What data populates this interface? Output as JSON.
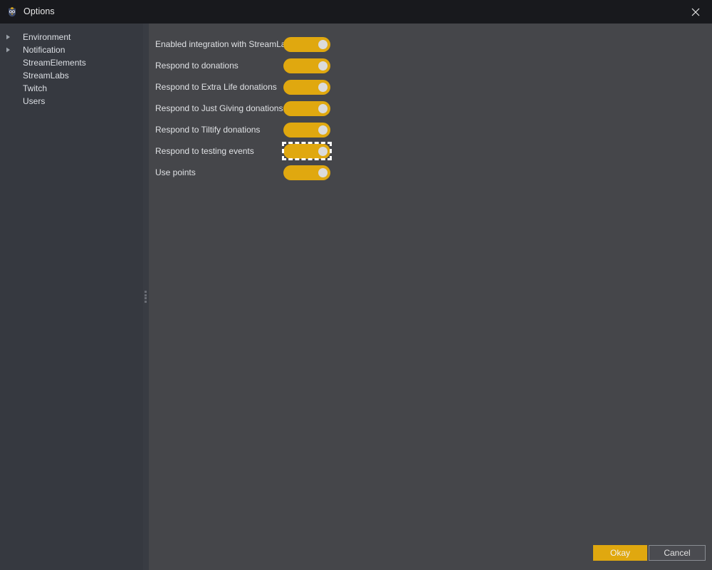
{
  "window": {
    "title": "Options",
    "icon": "app-owl-icon",
    "close_label": "✕"
  },
  "sidebar": {
    "items": [
      {
        "label": "Environment",
        "expandable": true,
        "selected": false
      },
      {
        "label": "Notification",
        "expandable": true,
        "selected": false
      },
      {
        "label": "StreamElements",
        "expandable": false,
        "selected": false
      },
      {
        "label": "StreamLabs",
        "expandable": false,
        "selected": false
      },
      {
        "label": "Twitch",
        "expandable": false,
        "selected": false
      },
      {
        "label": "Users",
        "expandable": false,
        "selected": false
      }
    ]
  },
  "main": {
    "options": [
      {
        "label": "Enabled integration with StreamLabs",
        "value": "on",
        "focused": false
      },
      {
        "label": "Respond to donations",
        "value": "on",
        "focused": false
      },
      {
        "label": "Respond to Extra Life donations",
        "value": "on",
        "focused": false
      },
      {
        "label": "Respond to Just Giving donations",
        "value": "on",
        "focused": false
      },
      {
        "label": "Respond to Tiltify donations",
        "value": "on",
        "focused": false
      },
      {
        "label": "Respond to testing events",
        "value": "on",
        "focused": true
      },
      {
        "label": "Use points",
        "value": "on",
        "focused": false
      }
    ]
  },
  "footer": {
    "okay_label": "Okay",
    "cancel_label": "Cancel"
  },
  "colors": {
    "titlebar": "#18191d",
    "sidebar": "#363940",
    "main": "#45464a",
    "accent": "#e0a80f",
    "toggle_knob": "#dbdbdb",
    "text": "#dfe1e4",
    "focus_ring": "#ffffff"
  }
}
